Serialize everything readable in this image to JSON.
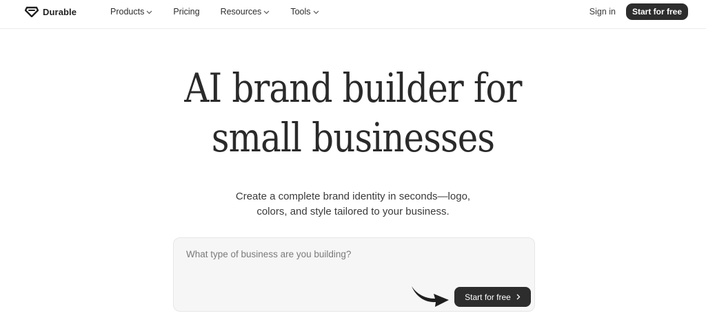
{
  "header": {
    "logo_text": "Durable",
    "nav": [
      {
        "label": "Products",
        "has_dropdown": true
      },
      {
        "label": "Pricing",
        "has_dropdown": false
      },
      {
        "label": "Resources",
        "has_dropdown": true
      },
      {
        "label": "Tools",
        "has_dropdown": true
      }
    ],
    "sign_in_label": "Sign in",
    "cta_label": "Start for free"
  },
  "hero": {
    "title_line1": "AI brand builder for",
    "title_line2": "small businesses",
    "subtitle_line1": "Create a complete brand identity in seconds—logo,",
    "subtitle_line2": "colors, and style tailored to your business."
  },
  "prompt": {
    "placeholder": "What type of business are you building?",
    "value": "",
    "cta_label": "Start for free"
  },
  "icons": {
    "logo": "diamond-logo-icon",
    "dropdown": "chevron-down-icon",
    "cta_arrow": "chevron-right-icon",
    "doodle": "curved-arrow-icon"
  },
  "colors": {
    "primary_dark": "#2d2d2d",
    "text": "#2b2b2b",
    "prompt_background": "#f6f6f6",
    "header_border": "#ececec"
  }
}
